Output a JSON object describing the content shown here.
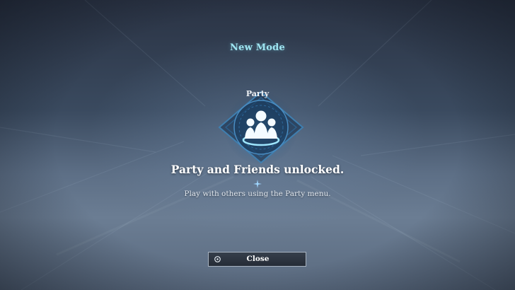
{
  "dialog": {
    "mode_title": "New Mode",
    "feature_name": "Party",
    "headline": "Party and Friends unlocked.",
    "description": "Play with others using the Party menu.",
    "close_label": "Close"
  },
  "icons": {
    "emblem": "party-emblem-icon",
    "sparkle": "sparkle-divider-icon",
    "button_prompt": "circle-button-icon"
  },
  "colors": {
    "mode_title": "#9fe6f2",
    "emblem_glow": "#4fc3ef",
    "button_border": "#a8b3c0"
  }
}
